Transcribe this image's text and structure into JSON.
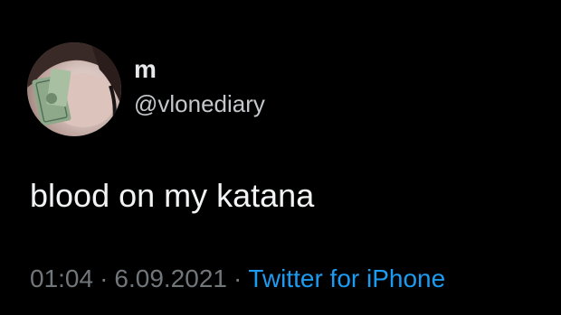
{
  "author": {
    "display_name": "m",
    "handle": "@vlonediary",
    "avatar_icon": "avatar-photo"
  },
  "tweet": {
    "text": "blood on my katana"
  },
  "meta": {
    "time": "01:04",
    "separator": "·",
    "date": "6.09.2021",
    "source": "Twitter for iPhone"
  },
  "colors": {
    "background": "#000000",
    "primary_text": "#e7e9ea",
    "secondary_text": "#71767b",
    "link": "#1d9bf0"
  }
}
